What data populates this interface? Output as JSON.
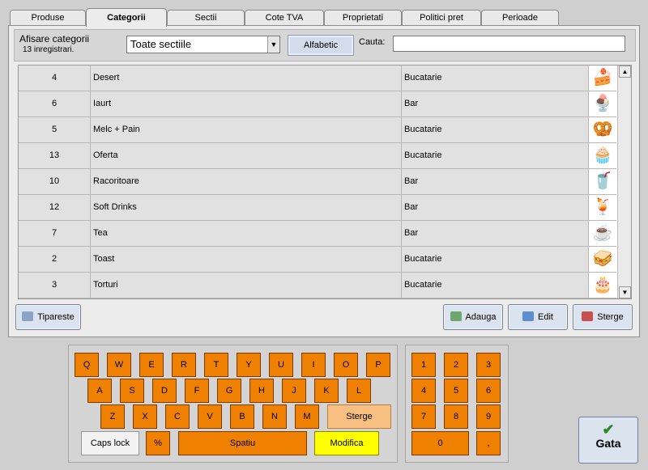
{
  "tabs": [
    "Produse",
    "Categorii",
    "Sectii",
    "Cote TVA",
    "Proprietati",
    "Politici pret",
    "Perioade"
  ],
  "active_tab": "Categorii",
  "filter": {
    "title": "Afisare categorii",
    "count": "13 inregistrari.",
    "section_select": "Toate sectiile",
    "sort_button": "Alfabetic",
    "search_label": "Cauta:",
    "search_value": ""
  },
  "rows": [
    {
      "id": "4",
      "name": "Desert",
      "section": "Bucatarie",
      "icon": "cake-icon"
    },
    {
      "id": "6",
      "name": "Iaurt",
      "section": "Bar",
      "icon": "yogurt-icon"
    },
    {
      "id": "5",
      "name": "Melc + Pain",
      "section": "Bucatarie",
      "icon": "pretzel-icon"
    },
    {
      "id": "13",
      "name": "Oferta",
      "section": "Bucatarie",
      "icon": "offer-icon"
    },
    {
      "id": "10",
      "name": "Racoritoare",
      "section": "Bar",
      "icon": "cola-icon"
    },
    {
      "id": "12",
      "name": "Soft Drinks",
      "section": "Bar",
      "icon": "drink-glass-icon"
    },
    {
      "id": "7",
      "name": "Tea",
      "section": "Bar",
      "icon": "tea-cup-icon"
    },
    {
      "id": "2",
      "name": "Toast",
      "section": "Bucatarie",
      "icon": "toast-icon"
    },
    {
      "id": "3",
      "name": "Torturi",
      "section": "Bucatarie",
      "icon": "torte-icon"
    }
  ],
  "actions": {
    "print": "Tipareste",
    "add": "Adauga",
    "edit": "Edit",
    "delete": "Sterge"
  },
  "keyboard": {
    "row1": [
      "Q",
      "W",
      "E",
      "R",
      "T",
      "Y",
      "U",
      "I",
      "O",
      "P"
    ],
    "row2": [
      "A",
      "S",
      "D",
      "F",
      "G",
      "H",
      "J",
      "K",
      "L"
    ],
    "row3": [
      "Z",
      "X",
      "C",
      "V",
      "B",
      "N",
      "M"
    ],
    "backspace": "Sterge",
    "caps": "Caps lock",
    "percent": "%",
    "space": "Spatiu",
    "modify": "Modifica"
  },
  "numpad": {
    "keys": [
      "1",
      "2",
      "3",
      "4",
      "5",
      "6",
      "7",
      "8",
      "9"
    ],
    "zero": "0",
    "dot": ","
  },
  "done_button": "Gata",
  "colors": {
    "key_orange": "#f08000",
    "key_light": "#f8bf83",
    "key_modify": "#ffff00",
    "button_blue": "#dbe3ee"
  }
}
